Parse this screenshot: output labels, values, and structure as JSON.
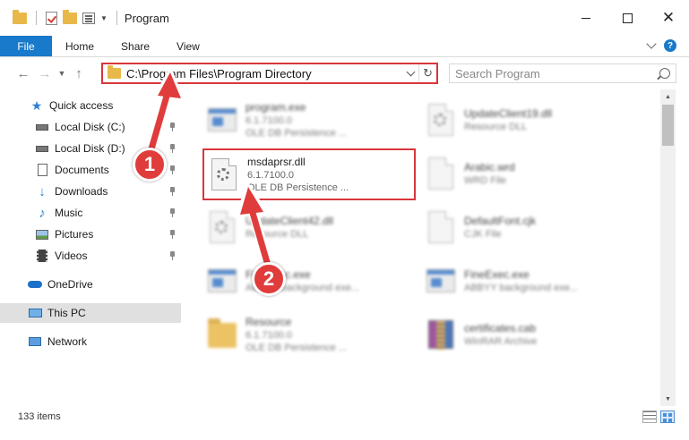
{
  "window": {
    "title": "Program"
  },
  "ribbon": {
    "tabs": [
      "File",
      "Home",
      "Share",
      "View"
    ]
  },
  "address": {
    "path": "C:\\Program Files\\Program Directory"
  },
  "search": {
    "placeholder": "Search Program"
  },
  "sidebar": {
    "items": [
      {
        "label": "Quick access",
        "icon": "star-icon",
        "pinned": false
      },
      {
        "label": "Local Disk (C:)",
        "icon": "drive-icon",
        "pinned": true
      },
      {
        "label": "Local Disk (D:)",
        "icon": "drive-icon",
        "pinned": true
      },
      {
        "label": "Documents",
        "icon": "documents-icon",
        "pinned": true
      },
      {
        "label": "Downloads",
        "icon": "download-arrow-icon",
        "pinned": true
      },
      {
        "label": "Music",
        "icon": "music-note-icon",
        "pinned": true
      },
      {
        "label": "Pictures",
        "icon": "pictures-icon",
        "pinned": true
      },
      {
        "label": "Videos",
        "icon": "film-icon",
        "pinned": true
      },
      {
        "label": "OneDrive",
        "icon": "cloud-icon",
        "pinned": false
      },
      {
        "label": "This PC",
        "icon": "monitor-icon",
        "pinned": false,
        "selected": true
      },
      {
        "label": "Network",
        "icon": "network-icon",
        "pinned": false
      }
    ]
  },
  "files": [
    {
      "name": "program.exe",
      "version": "6.1.7100.0",
      "desc": "OLE DB Persistence ...",
      "icon": "program-icon"
    },
    {
      "name": "UpdateClient19.dll",
      "desc": "Resource DLL",
      "icon": "dll-icon"
    },
    {
      "name": "msdaprsr.dll",
      "version": "6.1.7100.0",
      "desc": "OLE DB Persistence ...",
      "icon": "dll-gear-icon",
      "highlighted": true
    },
    {
      "name": "Arabic.wrd",
      "desc": "WRD File",
      "icon": "blank-file-icon"
    },
    {
      "name": "UpdateClient42.dll",
      "desc": "Resource DLL",
      "icon": "dll-icon"
    },
    {
      "name": "DefaultFont.cjk",
      "desc": "CJK File",
      "icon": "blank-file-icon"
    },
    {
      "name": "FineExec.exe",
      "desc": "ABBYY background exe...",
      "icon": "exe-icon"
    },
    {
      "name": "FineExec.exe",
      "desc": "ABBYY background exe...",
      "icon": "exe-icon"
    },
    {
      "name": "Resource",
      "version": "6.1.7100.0",
      "desc": "OLE DB Persistence ...",
      "icon": "folder-icon"
    },
    {
      "name": "certificates.cab",
      "desc": "WinRAR Archive",
      "icon": "archive-icon"
    }
  ],
  "status": {
    "item_count": "133 items"
  },
  "annotations": {
    "step1": "1",
    "step2": "2",
    "accent": "#d9353a"
  }
}
